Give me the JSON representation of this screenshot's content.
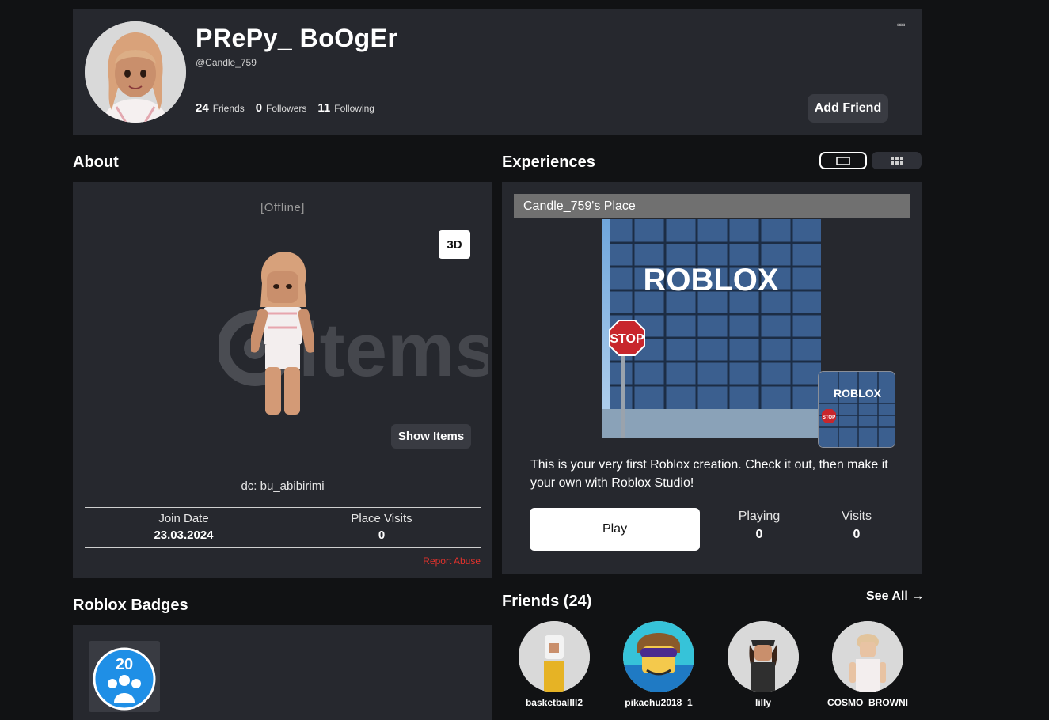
{
  "profile": {
    "display_name": "PRePy_ BoOgEr",
    "username": "@Candle_759",
    "friends_count": "24",
    "friends_label": "Friends",
    "followers_count": "0",
    "followers_label": "Followers",
    "following_count": "11",
    "following_label": "Following",
    "more_label": "▫▫▫",
    "add_friend_label": "Add Friend"
  },
  "about": {
    "title": "About",
    "status": "[Offline]",
    "view_3d_label": "3D",
    "watermark_text": "items",
    "show_items_label": "Show Items",
    "bio": "dc: bu_abibirimi",
    "join_date_label": "Join Date",
    "join_date_value": "23.03.2024",
    "place_visits_label": "Place Visits",
    "place_visits_value": "0",
    "report_label": "Report Abuse"
  },
  "experiences": {
    "title": "Experiences",
    "place_name": "Candle_759's Place",
    "thumbnail_logo": "ROBLOX",
    "thumbnail_sign": "STOP",
    "description": "This is your very first Roblox creation. Check it out, then make it your own with Roblox Studio!",
    "play_label": "Play",
    "playing_label": "Playing",
    "playing_value": "0",
    "visits_label": "Visits",
    "visits_value": "0"
  },
  "badges": {
    "title": "Roblox Badges",
    "badge_number": "20"
  },
  "friends": {
    "title": "Friends (24)",
    "see_all_label": "See All →",
    "items": [
      {
        "name": "basketballll2"
      },
      {
        "name": "pikachu2018_1"
      },
      {
        "name": "lilly"
      },
      {
        "name": "COSMO_BROWNI"
      }
    ]
  },
  "colors": {
    "background": "#111214",
    "card": "#26282e",
    "button": "#393b42",
    "report_red": "#e0322c"
  }
}
